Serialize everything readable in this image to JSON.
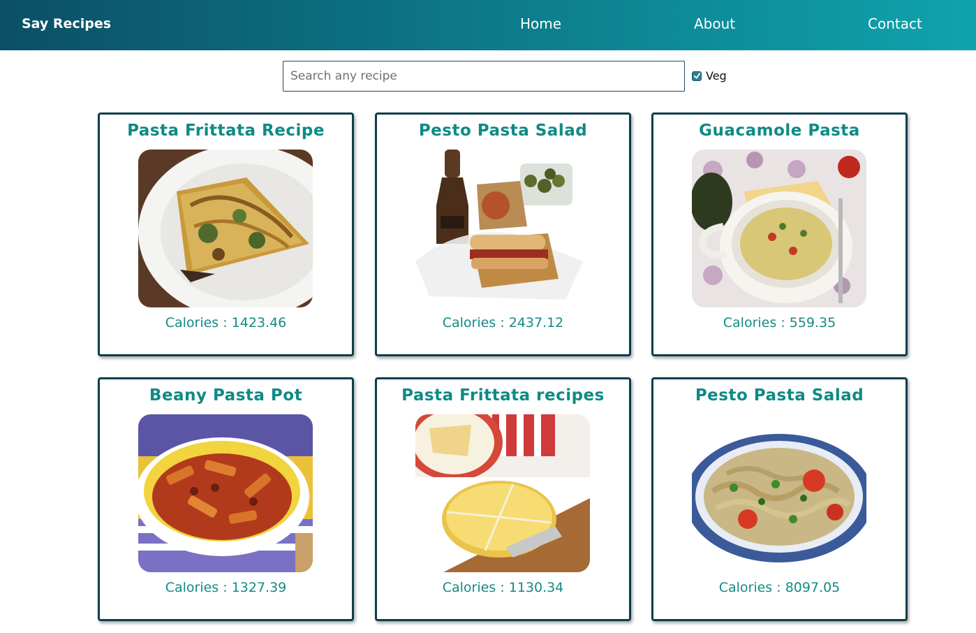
{
  "nav": {
    "brand": "Say Recipes",
    "links": [
      "Home",
      "About",
      "Contact"
    ]
  },
  "search": {
    "placeholder": "Search any recipe",
    "value": ""
  },
  "filter": {
    "label": "Veg",
    "checked": true
  },
  "recipes": [
    {
      "title": "Pasta Frittata Recipe",
      "calories": "Calories : 1423.46",
      "image": "frittata-slice-on-plate"
    },
    {
      "title": "Pesto Pasta Salad",
      "calories": "Calories : 2437.12",
      "image": "sandwich-bottle-olives"
    },
    {
      "title": "Guacamole Pasta",
      "calories": "Calories : 559.35",
      "image": "penne-bowl-avocado-tomato"
    },
    {
      "title": "Beany Pasta Pot",
      "calories": "Calories : 1327.39",
      "image": "penne-tomato-bowl"
    },
    {
      "title": "Pasta Frittata recipes",
      "calories": "Calories : 1130.34",
      "image": "frittata-on-board"
    },
    {
      "title": "Pesto Pasta Salad",
      "calories": "Calories : 8097.05",
      "image": "fusilli-pesto-plate"
    }
  ],
  "colors": {
    "nav_start": "#0b4f66",
    "nav_end": "#0fa3ad",
    "title": "#0f8a85",
    "card_border": "#0c3e4c"
  }
}
